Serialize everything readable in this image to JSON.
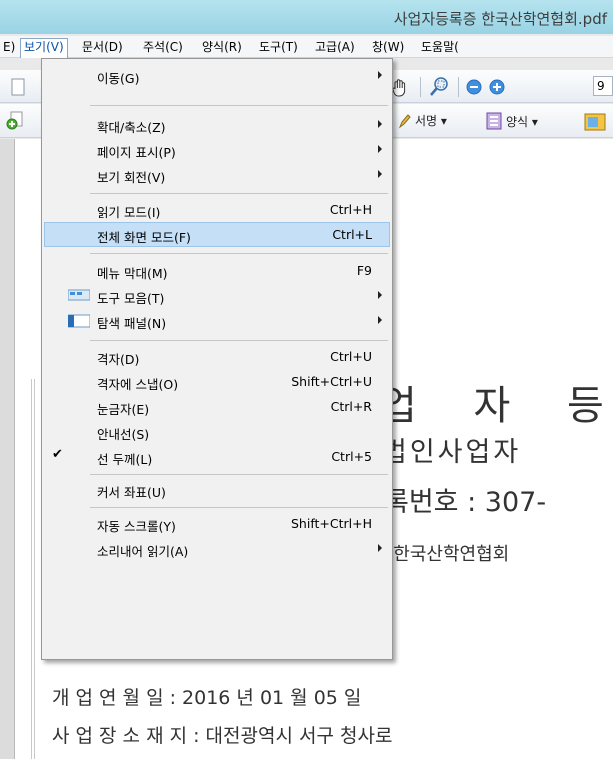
{
  "window": {
    "title": "사업자등록증 한국산학연협회.pdf"
  },
  "menubar": {
    "items": [
      {
        "label": "E)"
      },
      {
        "label": "보기(V)"
      },
      {
        "label": "문서(D)"
      },
      {
        "label": "주석(C)"
      },
      {
        "label": "양식(R)"
      },
      {
        "label": "도구(T)"
      },
      {
        "label": "고급(A)"
      },
      {
        "label": "창(W)"
      },
      {
        "label": "도움말("
      }
    ]
  },
  "toolbar": {
    "zoom_value": "9",
    "sign_label": "서명 ▾",
    "form_label": "양식 ▾"
  },
  "view_menu": {
    "items": [
      {
        "label": "이동(G)",
        "shortcut": "",
        "submenu": true
      },
      {
        "label": "확대/축소(Z)",
        "shortcut": "",
        "submenu": true
      },
      {
        "label": "페이지 표시(P)",
        "shortcut": "",
        "submenu": true
      },
      {
        "label": "보기 회전(V)",
        "shortcut": "",
        "submenu": true
      },
      {
        "label": "읽기 모드(I)",
        "shortcut": "Ctrl+H",
        "submenu": false
      },
      {
        "label": "전체 화면 모드(F)",
        "shortcut": "Ctrl+L",
        "submenu": false,
        "highlighted": true
      },
      {
        "label": "메뉴 막대(M)",
        "shortcut": "F9",
        "submenu": false
      },
      {
        "label": "도구 모음(T)",
        "shortcut": "",
        "submenu": true
      },
      {
        "label": "탐색 패널(N)",
        "shortcut": "",
        "submenu": true
      },
      {
        "label": "격자(D)",
        "shortcut": "Ctrl+U",
        "submenu": false
      },
      {
        "label": "격자에 스냅(O)",
        "shortcut": "Shift+Ctrl+U",
        "submenu": false
      },
      {
        "label": "눈금자(E)",
        "shortcut": "Ctrl+R",
        "submenu": false
      },
      {
        "label": "안내선(S)",
        "shortcut": "",
        "submenu": false
      },
      {
        "label": "선 두께(L)",
        "shortcut": "Ctrl+5",
        "submenu": false,
        "checked": true
      },
      {
        "label": "커서 좌표(U)",
        "shortcut": "",
        "submenu": false
      },
      {
        "label": "자동 스크롤(Y)",
        "shortcut": "Shift+Ctrl+H",
        "submenu": false
      },
      {
        "label": "소리내어 읽기(A)",
        "shortcut": "",
        "submenu": true
      }
    ]
  },
  "document": {
    "title": "업 자 등",
    "subtitle": "법인사업자",
    "reg_number": "록번호 : 307-",
    "company": "인 한국산학연협회",
    "open_date": "개 업 연 월 일 : 2016 년 01 월 05 일",
    "location": "사 업 장  소 재 지 : 대전광역시 서구 청사로"
  },
  "colors": {
    "highlight": "#c5dff6",
    "menu_bg": "#f1f1f1",
    "titlebar": "#a8dcea"
  }
}
